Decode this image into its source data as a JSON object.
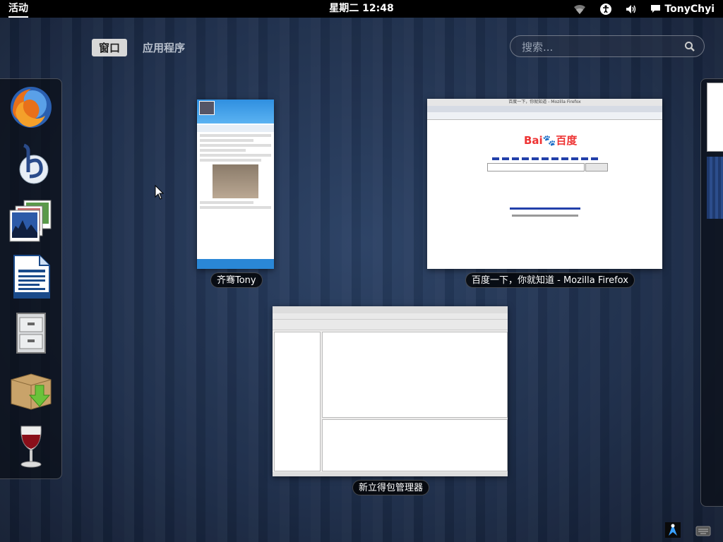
{
  "topbar": {
    "activities": "活动",
    "clock": "星期二 12:48",
    "user": "TonyChyi",
    "tray_icons": [
      "wifi-icon",
      "accessibility-icon",
      "volume-icon",
      "chat-icon"
    ]
  },
  "overview": {
    "tabs": [
      {
        "label": "窗口",
        "active": true
      },
      {
        "label": "应用程序",
        "active": false
      }
    ],
    "search": {
      "placeholder": "搜索..."
    }
  },
  "dash": {
    "items": [
      {
        "name": "firefox",
        "icon": "firefox-icon"
      },
      {
        "name": "banshee",
        "icon": "banshee-icon"
      },
      {
        "name": "photos",
        "icon": "shotwell-photos-icon"
      },
      {
        "name": "writer",
        "icon": "libreoffice-writer-icon"
      },
      {
        "name": "file-cabinet",
        "icon": "file-cabinet-icon"
      },
      {
        "name": "package-installer",
        "icon": "package-installer-icon"
      },
      {
        "name": "wine",
        "icon": "wine-glass-icon"
      }
    ]
  },
  "windows": [
    {
      "caption": "齐骞Tony"
    },
    {
      "caption": "百度一下，你就知道 - Mozilla Firefox"
    },
    {
      "caption": "新立得包管理器"
    }
  ],
  "firefox_preview": {
    "title": "百度一下，你就知道 - Mozilla Firefox",
    "logo": "Bai百度"
  },
  "colors": {
    "topbar": "#000000",
    "background": "#1d2d49",
    "active_tab": "#d8d8d8"
  }
}
